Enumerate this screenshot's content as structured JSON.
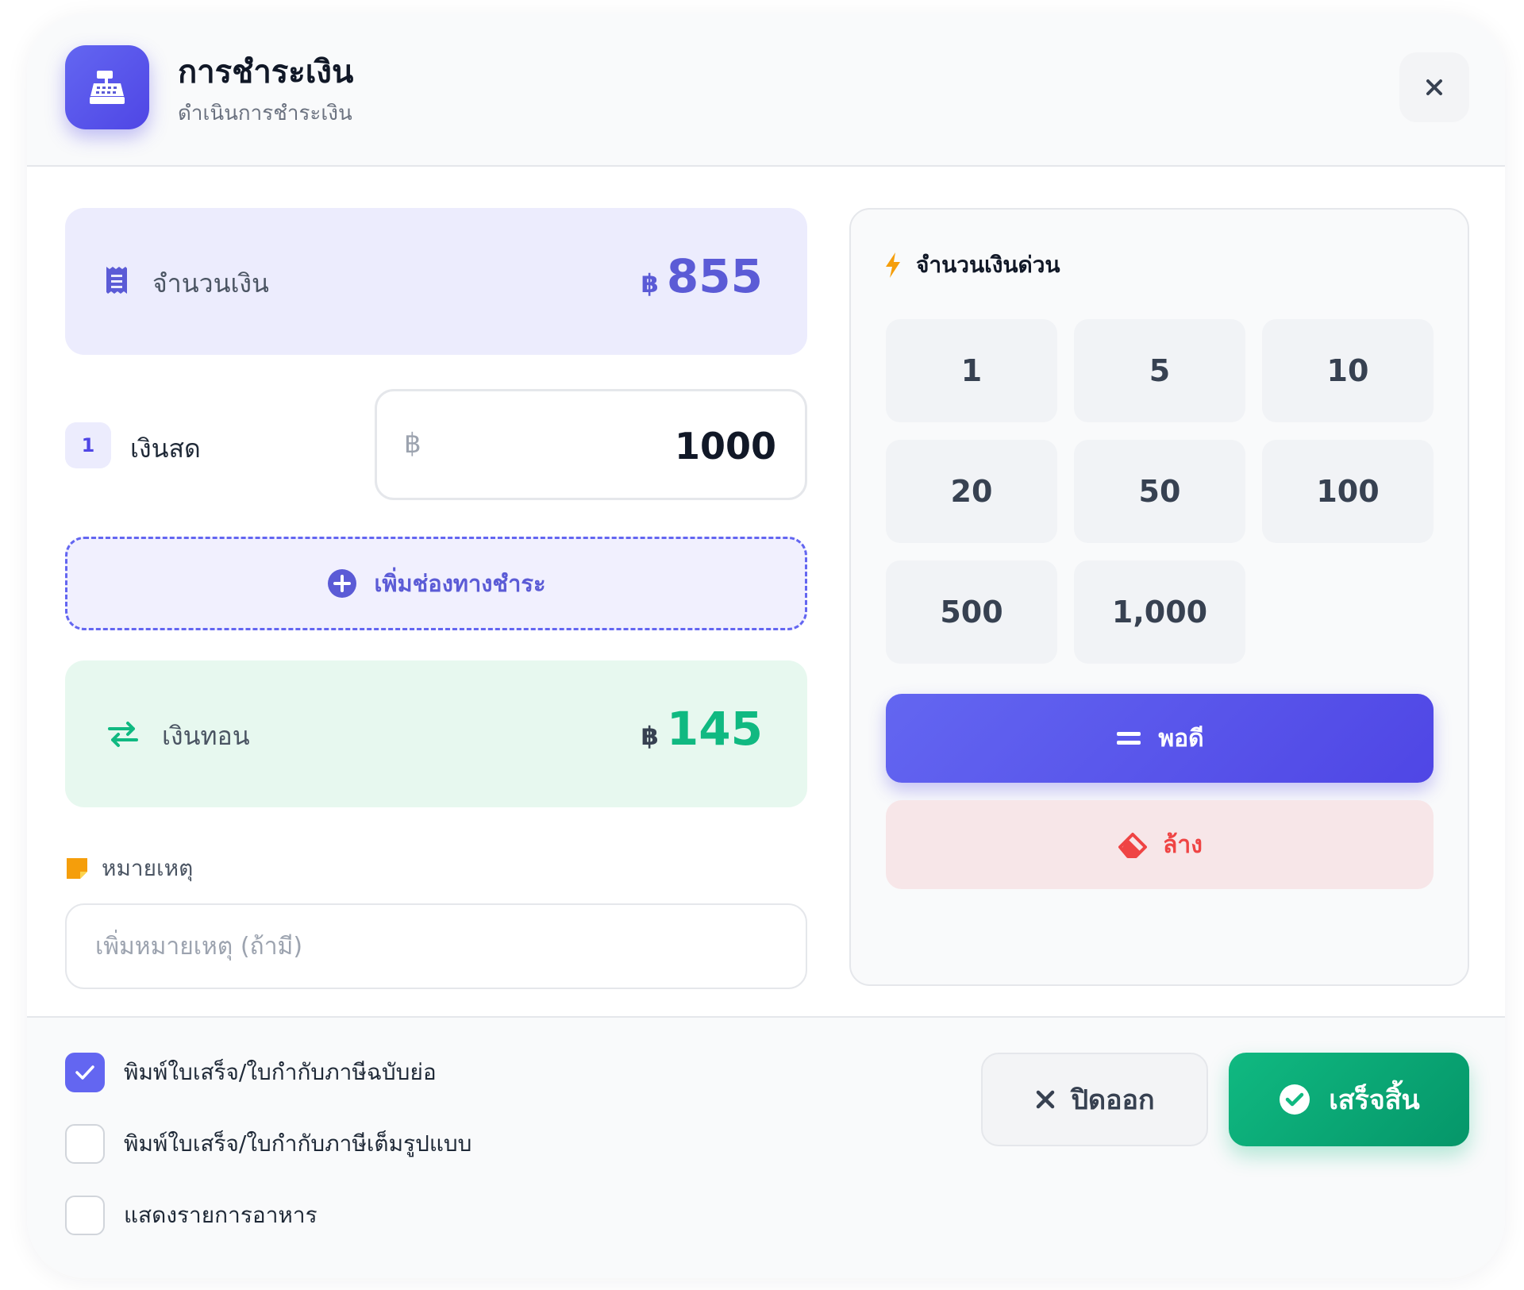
{
  "header": {
    "title": "การชำระเงิน",
    "subtitle": "ดำเนินการชำระเงิน",
    "icon": "cash-register-icon",
    "close_icon": "close-icon"
  },
  "amount": {
    "label": "จำนวนเงิน",
    "currency": "฿",
    "value": "855",
    "color": "#5b5bd6"
  },
  "payment_method": {
    "index": "1",
    "label": "เงินสด",
    "currency": "฿",
    "value": "1000"
  },
  "add_method": {
    "label": "เพิ่มช่องทางชำระ"
  },
  "change": {
    "label": "เงินทอน",
    "currency": "฿",
    "value": "145",
    "color": "#10b981"
  },
  "note": {
    "label": "หมายเหตุ",
    "placeholder": "เพิ่มหมายเหตุ (ถ้ามี)",
    "value": ""
  },
  "quick": {
    "title": "จำนวนเงินด่วน",
    "amounts": [
      "1",
      "5",
      "10",
      "20",
      "50",
      "100",
      "500",
      "1,000"
    ],
    "exact_label": "พอดี",
    "clear_label": "ล้าง"
  },
  "footer": {
    "options": [
      {
        "label": "พิมพ์ใบเสร็จ/ใบกำกับภาษีฉบับย่อ",
        "checked": true
      },
      {
        "label": "พิมพ์ใบเสร็จ/ใบกำกับภาษีเต็มรูปแบบ",
        "checked": false
      },
      {
        "label": "แสดงรายการอาหาร",
        "checked": false
      }
    ],
    "cancel_label": "ปิดออก",
    "confirm_label": "เสร็จสิ้น"
  },
  "colors": {
    "accent": "#6366f1",
    "success": "#10b981",
    "danger": "#ef4444",
    "warning": "#f59e0b"
  }
}
